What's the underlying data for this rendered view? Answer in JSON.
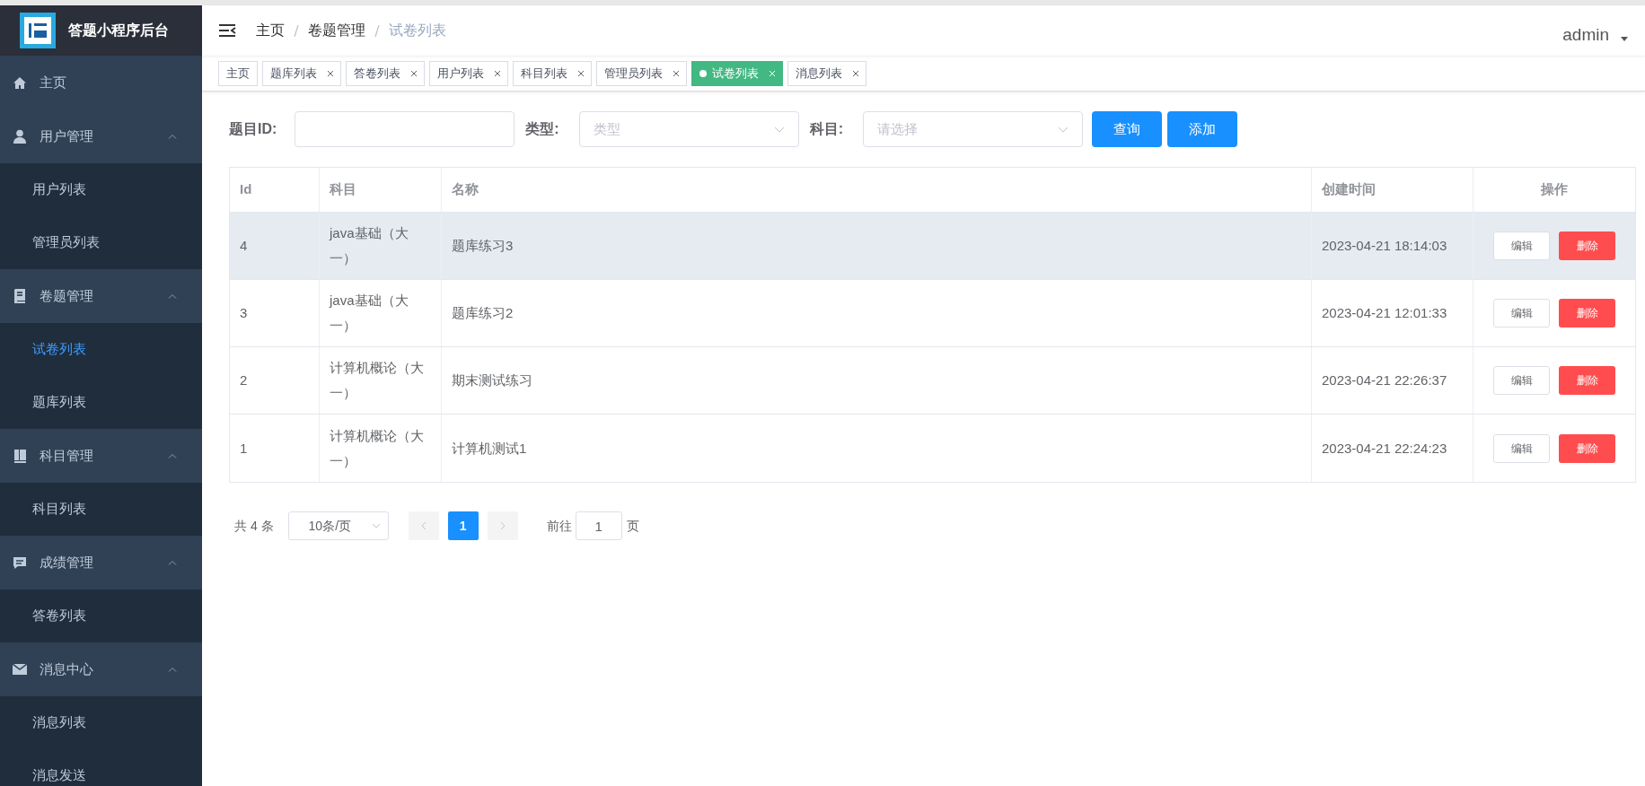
{
  "sidebar": {
    "title": "答题小程序后台",
    "items": [
      {
        "label": "主页"
      },
      {
        "label": "用户管理",
        "expanded": true,
        "children": [
          {
            "label": "用户列表",
            "selected": false
          },
          {
            "label": "管理员列表",
            "selected": false
          }
        ]
      },
      {
        "label": "卷题管理",
        "expanded": true,
        "children": [
          {
            "label": "试卷列表",
            "selected": true
          },
          {
            "label": "题库列表",
            "selected": false
          }
        ]
      },
      {
        "label": "科目管理",
        "expanded": true,
        "children": [
          {
            "label": "科目列表",
            "selected": false
          }
        ]
      },
      {
        "label": "成绩管理",
        "expanded": true,
        "children": [
          {
            "label": "答卷列表",
            "selected": false
          }
        ]
      },
      {
        "label": "消息中心",
        "expanded": true,
        "children": [
          {
            "label": "消息列表",
            "selected": false
          },
          {
            "label": "消息发送",
            "selected": false
          }
        ]
      }
    ]
  },
  "breadcrumb": [
    "主页",
    "卷题管理",
    "试卷列表"
  ],
  "user": "admin",
  "tabs": [
    {
      "label": "主页",
      "selected": false,
      "closable": false
    },
    {
      "label": "题库列表",
      "selected": false,
      "closable": true
    },
    {
      "label": "答卷列表",
      "selected": false,
      "closable": true
    },
    {
      "label": "用户列表",
      "selected": false,
      "closable": true
    },
    {
      "label": "科目列表",
      "selected": false,
      "closable": true
    },
    {
      "label": "管理员列表",
      "selected": false,
      "closable": true
    },
    {
      "label": "试卷列表",
      "selected": true,
      "closable": true
    },
    {
      "label": "消息列表",
      "selected": false,
      "closable": true
    }
  ],
  "filters": [
    {
      "label": "题目ID:",
      "kind": "input"
    },
    {
      "label": "类型:",
      "kind": "select",
      "placeholder": "类型"
    },
    {
      "label": "科目:",
      "kind": "select",
      "placeholder": "请选择"
    }
  ],
  "buttons": [
    "查询",
    "添加"
  ],
  "table": {
    "columns": [
      "Id",
      "科目",
      "名称",
      "创建时间",
      "操作"
    ],
    "rows": [
      {
        "highlighted": true,
        "cells": [
          "4",
          "java基础（大一）",
          "题库练习3",
          "2023-04-21 18:14:03"
        ],
        "actions": [
          "编辑",
          "删除"
        ]
      },
      {
        "highlighted": false,
        "cells": [
          "3",
          "java基础（大一）",
          "题库练习2",
          "2023-04-21 12:01:33"
        ],
        "actions": [
          "编辑",
          "删除"
        ]
      },
      {
        "highlighted": false,
        "cells": [
          "2",
          "计算机概论（大一）",
          "期末测试练习",
          "2023-04-21 22:26:37"
        ],
        "actions": [
          "编辑",
          "删除"
        ]
      },
      {
        "highlighted": false,
        "cells": [
          "1",
          "计算机概论（大一）",
          "计算机测试1",
          "2023-04-21 22:24:23"
        ],
        "actions": [
          "编辑",
          "删除"
        ]
      }
    ]
  },
  "pagination": {
    "total": "共 4 条",
    "page_size": "10条/页",
    "pages": [
      {
        "label": "1",
        "selected": true
      }
    ],
    "goto_label": "前往",
    "goto_value": "1",
    "goto_suffix": "页"
  }
}
